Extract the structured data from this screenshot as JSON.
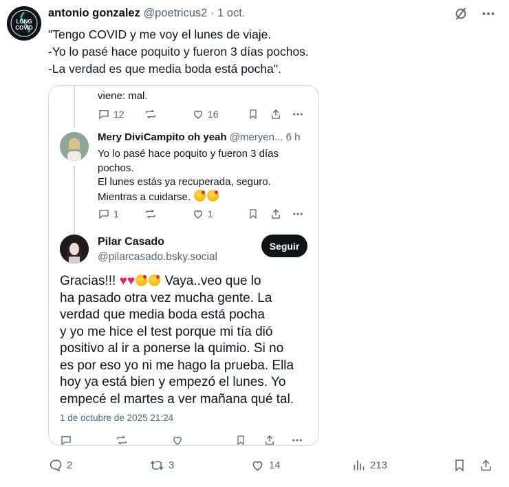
{
  "post": {
    "author_name": "antonio gonzalez",
    "author_handle": "@poetricus2",
    "separator": "·",
    "date": "1 oct.",
    "avatar_text_top": "LONG",
    "avatar_text_bottom": "COVID",
    "text_lines": [
      "\"Tengo COVID y me voy el lunes de viaje.",
      "-Yo lo pasé hace poquito y fueron 3 días pochos.",
      "-La verdad es que media boda está pocha\"."
    ],
    "stats": {
      "replies": "2",
      "reposts": "3",
      "likes": "14",
      "views": "213"
    }
  },
  "embedded": {
    "clipped_text": "viene: mal.",
    "prev_actions": {
      "replies": "12",
      "likes": "16"
    },
    "reply": {
      "name": "Mery DiviCampito oh yeah",
      "handle_time": "@meryen... 6 h",
      "lines": [
        "Yo lo pasé hace poquito y fueron 3 días",
        "pochos.",
        "El lunes estás ya recuperada, seguro.",
        "Mientras a cuidarse."
      ],
      "actions": {
        "replies": "1",
        "likes": "1"
      }
    },
    "focus": {
      "name": "Pilar Casado",
      "handle": "@pilarcasado.bsky.social",
      "follow_label": "Seguir",
      "first_line_start": "Gracias!!!",
      "first_line_end": "Vaya..veo que lo",
      "lines": [
        "ha pasado otra vez mucha gente. La",
        "verdad que media boda está pocha",
        "y yo me hice el test porque mi tía dió",
        "positivo al ir a ponerse la quimio. Si no",
        "es por eso yo ni me hago la prueba. Ella",
        "hoy ya está bien y empezó el lunes. Yo",
        "empecé el martes a ver mañana qué tal."
      ],
      "date": "1 de octubre de 2025 21:24"
    }
  },
  "icons": {
    "grok": "grok-icon",
    "more": "more-icon",
    "reply": "reply-icon",
    "repost": "repost-icon",
    "like": "heart-icon",
    "views": "views-icon",
    "bookmark": "bookmark-icon",
    "share": "share-icon"
  },
  "colors": {
    "text": "#0f1419",
    "muted": "#536471",
    "border": "#cfd9de",
    "heart": "#e0245e"
  }
}
